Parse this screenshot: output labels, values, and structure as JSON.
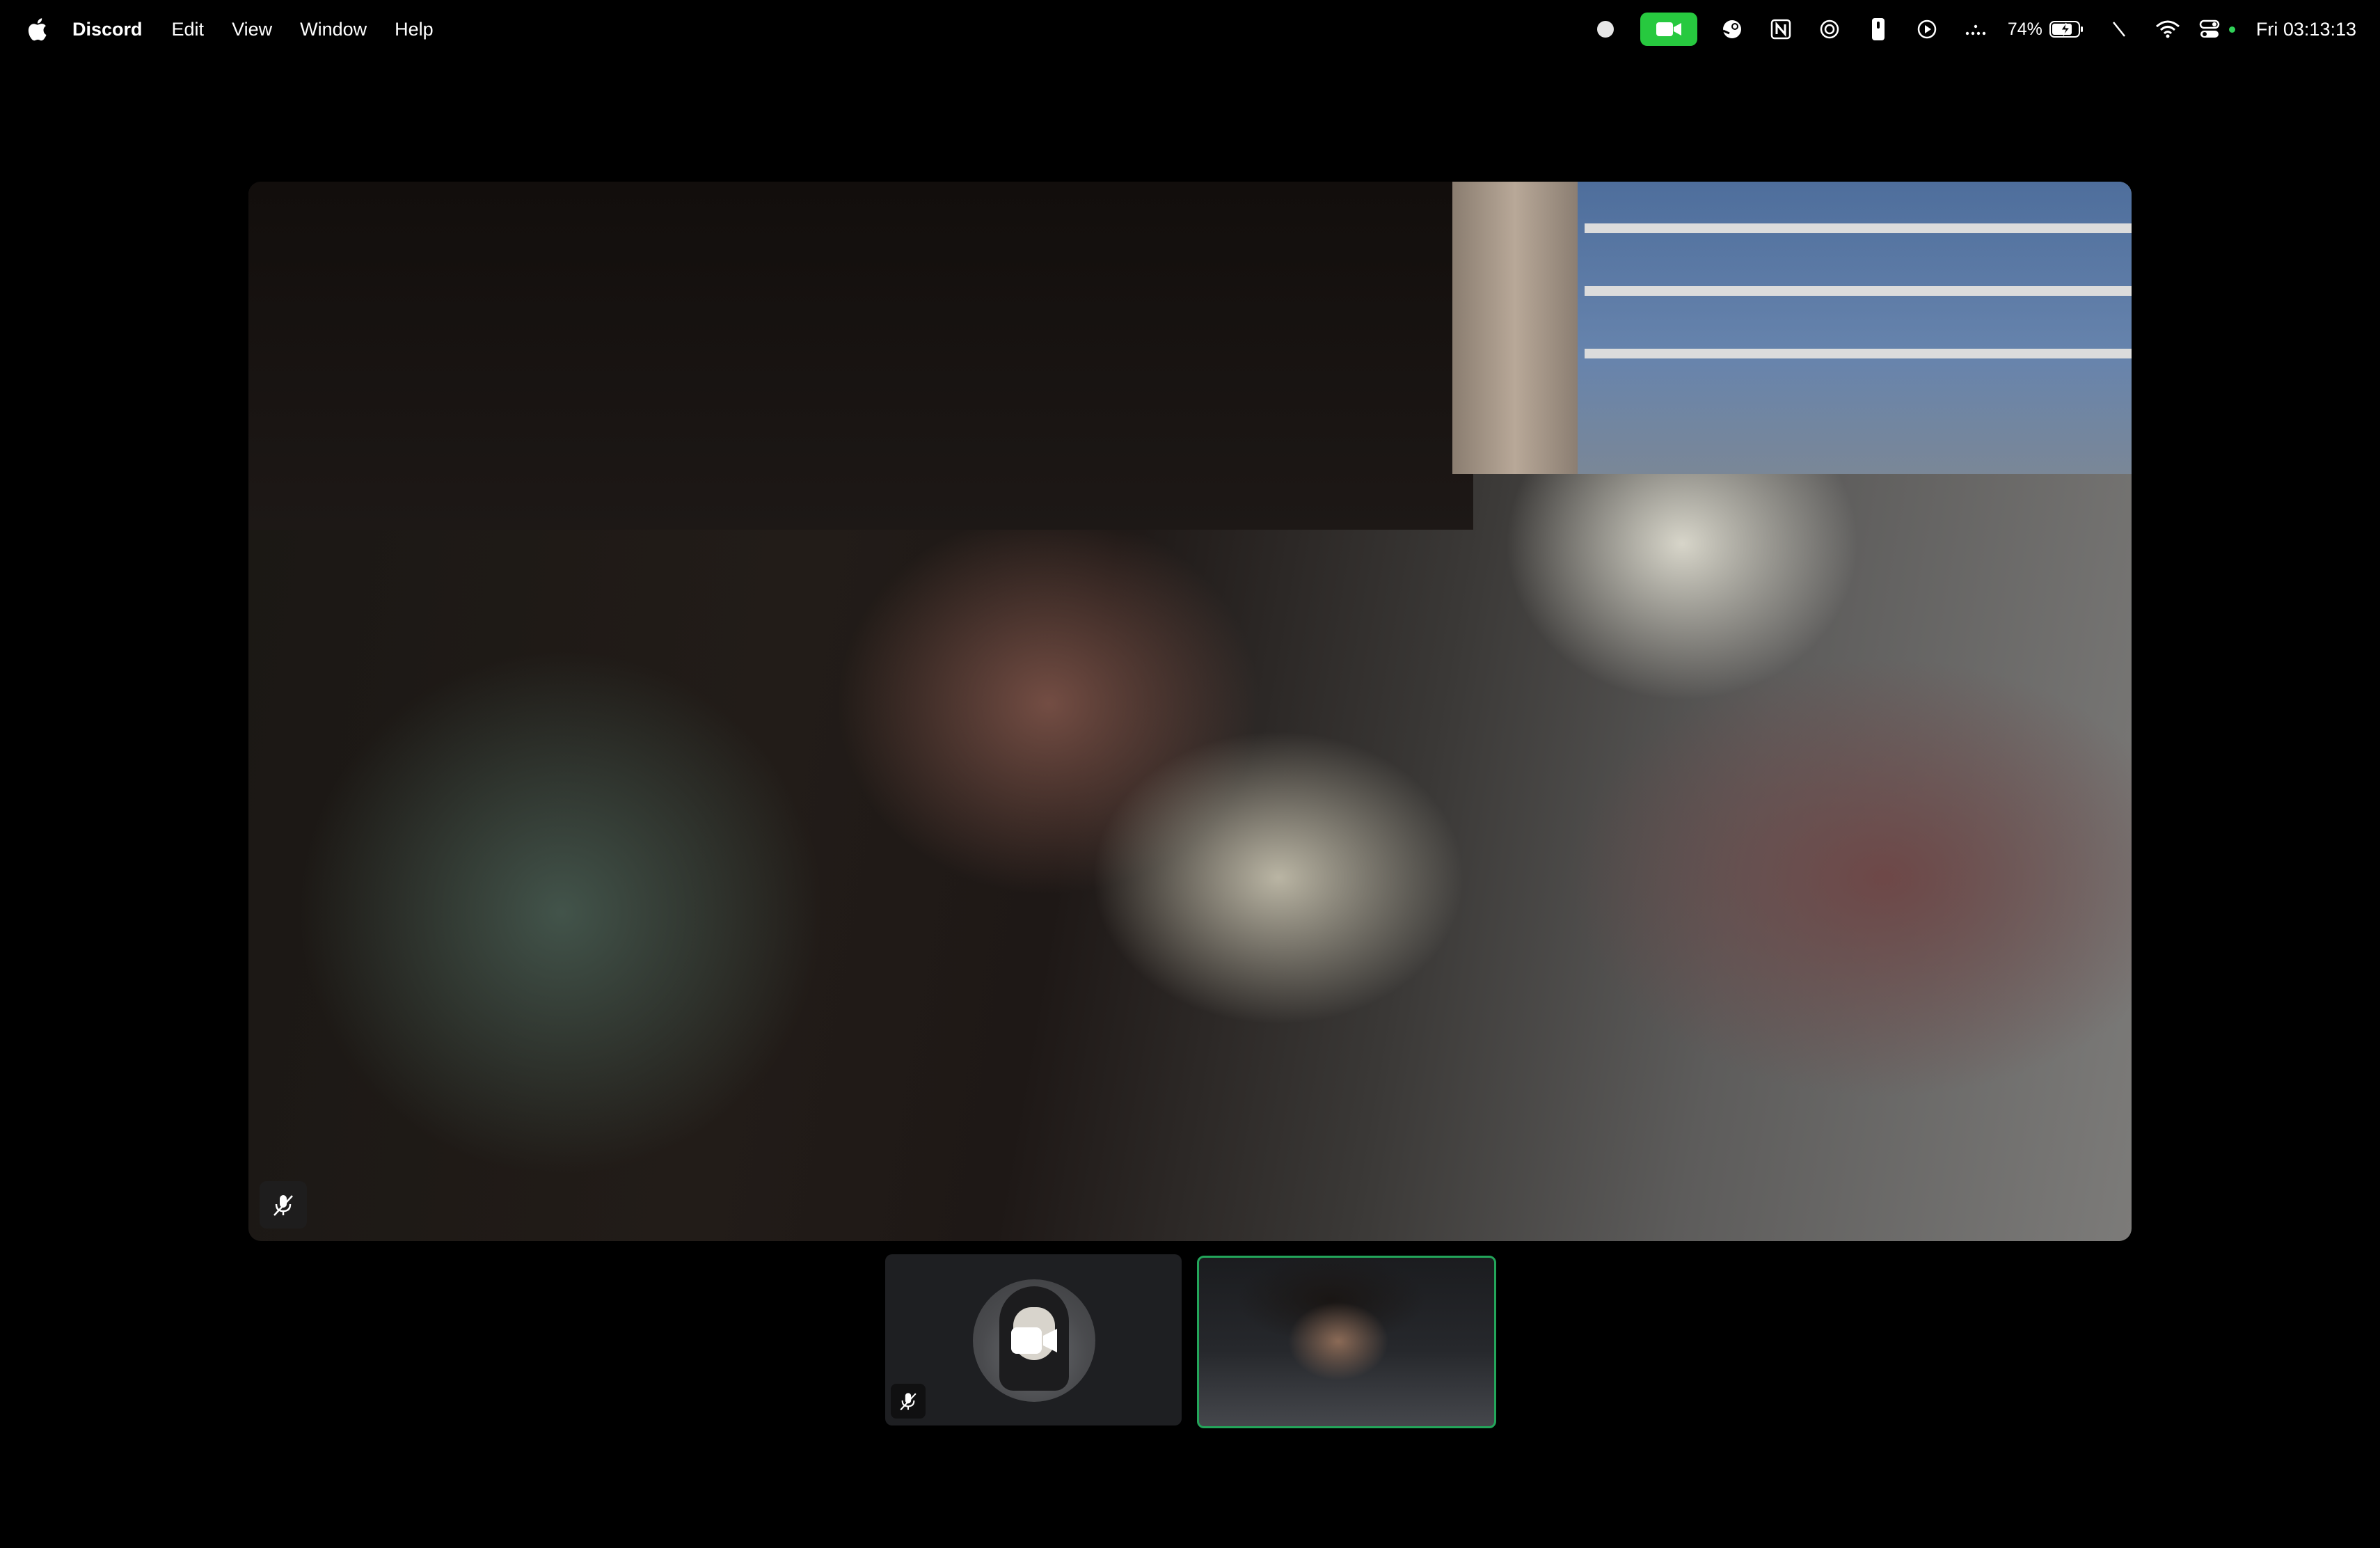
{
  "menubar": {
    "app_name": "Discord",
    "items": [
      "Edit",
      "View",
      "Window",
      "Help"
    ],
    "battery_percent": "74%",
    "clock": "Fri 03:13:13",
    "tray_icons": [
      "record-dot-icon",
      "facetime-camera-icon",
      "steam-icon",
      "notion-icon",
      "focus-icon",
      "tablet-icon",
      "play-icon",
      "dots-icon",
      "battery-icon",
      "slash-icon",
      "wifi-icon",
      "control-center-icon"
    ]
  },
  "call": {
    "main_video": {
      "muted": true,
      "icon": "mic-muted-icon"
    },
    "participants": [
      {
        "camera_off": true,
        "muted": true,
        "speaking": false
      },
      {
        "camera_off": false,
        "muted": false,
        "speaking": true
      }
    ]
  },
  "colors": {
    "speaking_border": "#23a55a",
    "facetime_green": "#27c93f",
    "tile_bg": "#1e1f22"
  }
}
